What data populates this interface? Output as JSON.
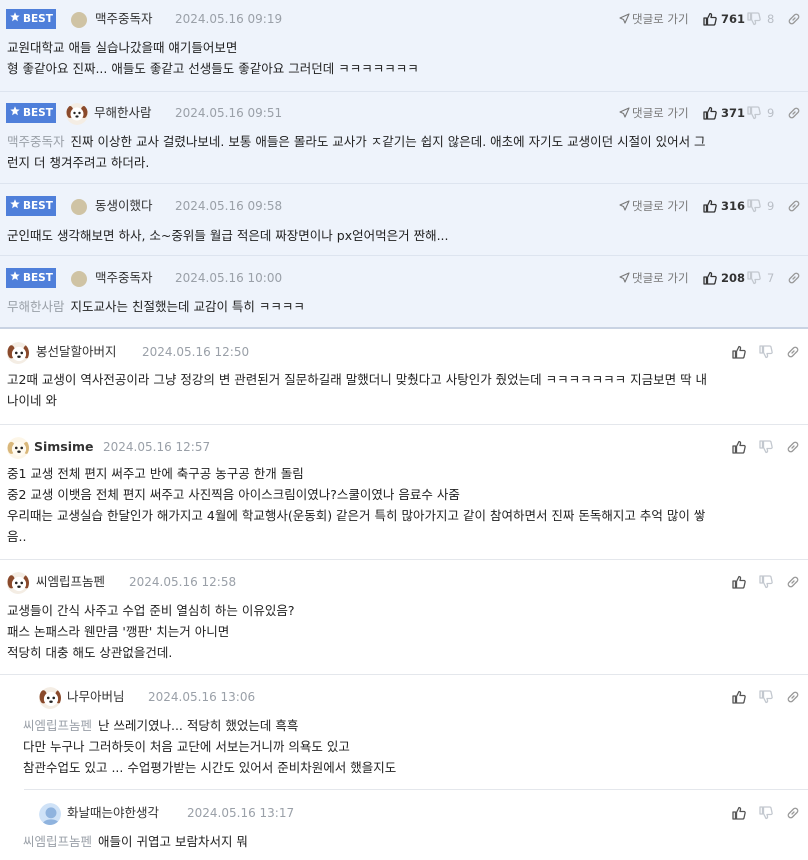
{
  "best_label": "BEST",
  "goto_label": "댓글로 가기",
  "comments": [
    {
      "nick": "맥주중독자",
      "date": "2024.05.16 09:19",
      "like": "761",
      "dislike": "8",
      "reply_to": "",
      "lines": [
        "교원대학교 애들 실습나갔을때 얘기들어보면",
        "형 좋같아요 진짜... 애들도 좋같고 선생들도 좋같아요 그러던데 ㅋㅋㅋㅋㅋㅋㅋ"
      ]
    },
    {
      "nick": "무해한사람",
      "date": "2024.05.16 09:51",
      "like": "371",
      "dislike": "9",
      "reply_to": "맥주중독자",
      "lines": [
        "진짜 이상한 교사 걸렸나보네. 보통 애들은 몰라도 교사가 ㅈ같기는 쉽지 않은데. 애초에 자기도 교생이던 시절이 있어서 그",
        "런지 더 챙겨주려고 하더라."
      ]
    },
    {
      "nick": "동생이했다",
      "date": "2024.05.16 09:58",
      "like": "316",
      "dislike": "9",
      "reply_to": "",
      "lines": [
        "군인때도 생각해보면 하사, 소~중위들 월급 적은데 짜장면이나 px얻어먹은거 짠해..."
      ]
    },
    {
      "nick": "맥주중독자",
      "date": "2024.05.16 10:00",
      "like": "208",
      "dislike": "7",
      "reply_to": "무해한사람",
      "lines": [
        "지도교사는 친절했는데 교감이 특히 ㅋㅋㅋㅋ"
      ]
    },
    {
      "nick": "봉선달할아버지",
      "date": "2024.05.16 12:50",
      "reply_to": "",
      "lines": [
        "고2때 교생이 역사전공이라 그냥 정강의 변 관련된거 질문하길래 말했더니 맞췄다고 사탕인가 줬었는데 ㅋㅋㅋㅋㅋㅋㅋ 지금보면 딱 내",
        "나이네 와"
      ]
    },
    {
      "nick": "Simsime",
      "date": "2024.05.16 12:57",
      "reply_to": "",
      "lines": [
        "중1 교생 전체 편지 써주고 반에 축구공 농구공 한개 돌림",
        "중2 교생 이뱃음 전체 편지 써주고 사진찍음 아이스크림이였나?스쿨이였나 음료수 사줌",
        "우리때는 교생실습 한달인가 해가지고 4월에 학교행사(운동회) 같은거 특히 많아가지고 같이 참여하면서 진짜 돈독해지고 추억 많이 쌓",
        "음.."
      ]
    },
    {
      "nick": "씨엠립프놈펜",
      "date": "2024.05.16 12:58",
      "reply_to": "",
      "lines": [
        "교생들이 간식 사주고 수업 준비 열심히 하는 이유있음?",
        "패스 논패스라 웬만큼 '깽판' 치는거 아니면",
        "적당히 대충 해도 상관없을건데."
      ]
    },
    {
      "nick": "나무아버님",
      "date": "2024.05.16 13:06",
      "reply_to": "씨엠립프놈펜",
      "lines": [
        "난 쓰레기였나... 적당히 했었는데 흑흑",
        "다만 누구나 그러하듯이 처음 교단에 서보는거니까 의욕도 있고",
        "참관수업도 있고 ... 수업평가받는 시간도 있어서 준비차원에서 했을지도"
      ]
    },
    {
      "nick": "화날때는야한생각",
      "date": "2024.05.16 13:17",
      "reply_to": "씨엠립프놈펜",
      "lines": [
        "애들이 귀엽고 보람차서지 뭐"
      ]
    }
  ]
}
